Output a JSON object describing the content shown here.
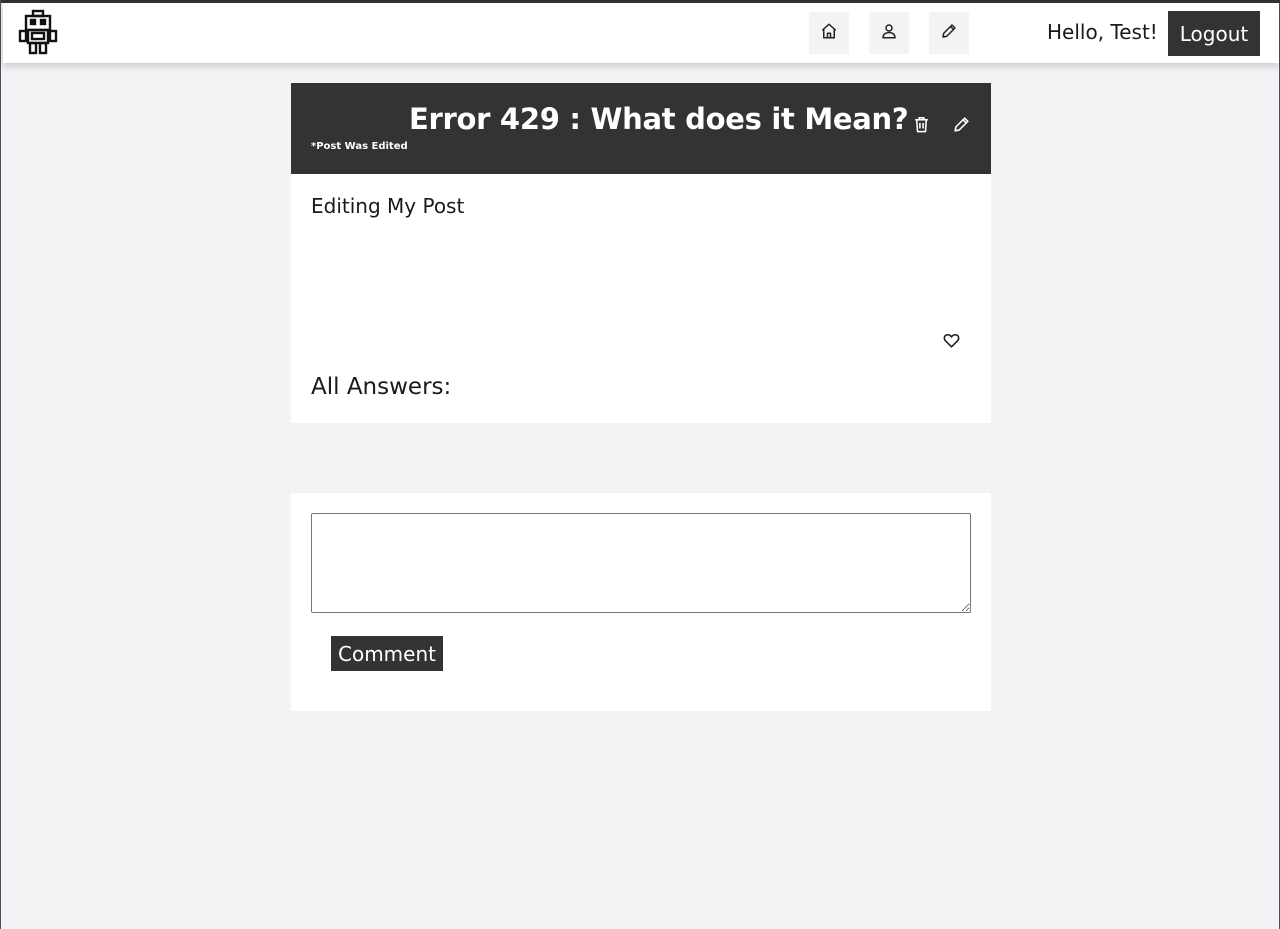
{
  "navbar": {
    "logo_icon": "robot-icon",
    "nav_items": [
      {
        "icon": "home-icon"
      },
      {
        "icon": "user-icon"
      },
      {
        "icon": "pencil-icon"
      }
    ],
    "greeting": "Hello, Test!",
    "logout_label": "Logout"
  },
  "post": {
    "title": "Error 429 : What does it Mean?",
    "edited_note": "*Post Was Edited",
    "body": "Editing My Post",
    "delete_icon": "trash-icon",
    "edit_icon": "pencil-icon",
    "like_icon": "heart-icon",
    "answers_heading": "All Answers:"
  },
  "comment_form": {
    "value": "",
    "submit_label": "Comment"
  },
  "colors": {
    "dark": "#333333",
    "background": "#f1f3f4",
    "card": "#ffffff"
  }
}
